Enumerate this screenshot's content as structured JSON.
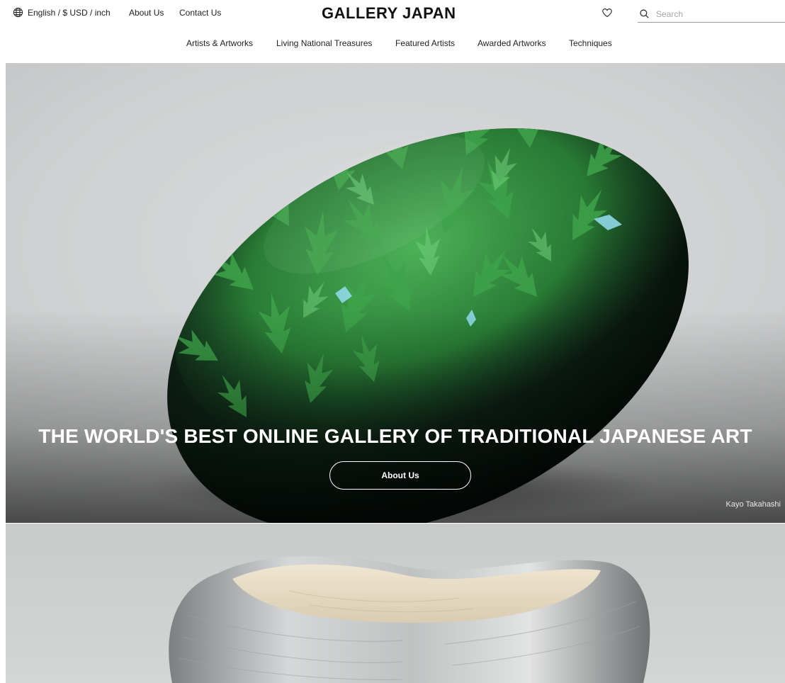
{
  "header": {
    "locale_label": "English / $ USD / inch",
    "about_label": "About Us",
    "contact_label": "Contact Us",
    "logo": "GALLERY JAPAN",
    "search_placeholder": "Search"
  },
  "nav": {
    "items": [
      {
        "label": "Artists & Artworks"
      },
      {
        "label": "Living National Treasures"
      },
      {
        "label": "Featured Artists"
      },
      {
        "label": "Awarded Artworks"
      },
      {
        "label": "Techniques"
      }
    ]
  },
  "hero": {
    "title": "THE WORLD'S BEST ONLINE GALLERY OF TRADITIONAL JAPANESE ART",
    "button_label": "About Us",
    "credit": "Kayo Takahashi"
  },
  "icons": {
    "locale": "globe-icon",
    "favorites": "heart-icon",
    "search": "search-icon"
  },
  "colors": {
    "text": "#1a1a1a",
    "hero_text": "#ffffff",
    "lacquer_green": "#2f8f3c",
    "lacquer_black": "#0f1a14"
  }
}
